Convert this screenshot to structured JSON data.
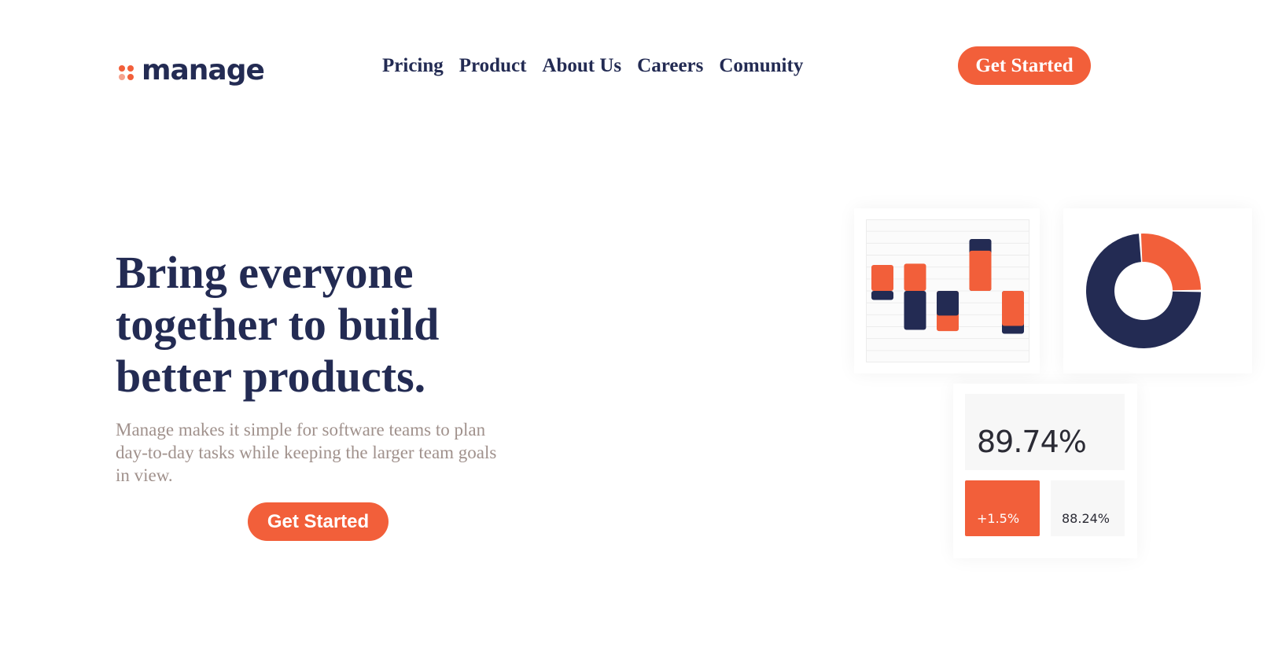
{
  "brand": {
    "name": "manage",
    "dot_colors": [
      "#f25f3a",
      "#f25f3a",
      "#f5a38f",
      "#f25f3a"
    ]
  },
  "nav": {
    "items": [
      {
        "label": "Pricing"
      },
      {
        "label": "Product"
      },
      {
        "label": "About Us"
      },
      {
        "label": "Careers"
      },
      {
        "label": "Comunity"
      }
    ],
    "cta_label": "Get Started"
  },
  "hero": {
    "title": "Bring everyone together to build better products.",
    "description": "Manage makes it simple for software teams to plan day-to-day tasks while keeping the larger team goals in view.",
    "cta_label": "Get Started"
  },
  "illustration": {
    "bar_columns": [
      {
        "orange": 1.0,
        "navy": -0.35
      },
      {
        "orange": 1.05,
        "navy": -1.5
      },
      {
        "orange": -1.55,
        "navy": -0.95
      },
      {
        "orange": 1.55,
        "navy": 2.0
      },
      {
        "orange": -1.35,
        "navy": -1.65
      }
    ],
    "donut_orange_fraction": 0.26,
    "stat_main": "89.74%",
    "stat_change": "+1.5%",
    "stat_secondary": "88.24%"
  },
  "colors": {
    "primary": "#f25f3a",
    "navy": "#232b53",
    "muted_text": "#a0918c"
  }
}
